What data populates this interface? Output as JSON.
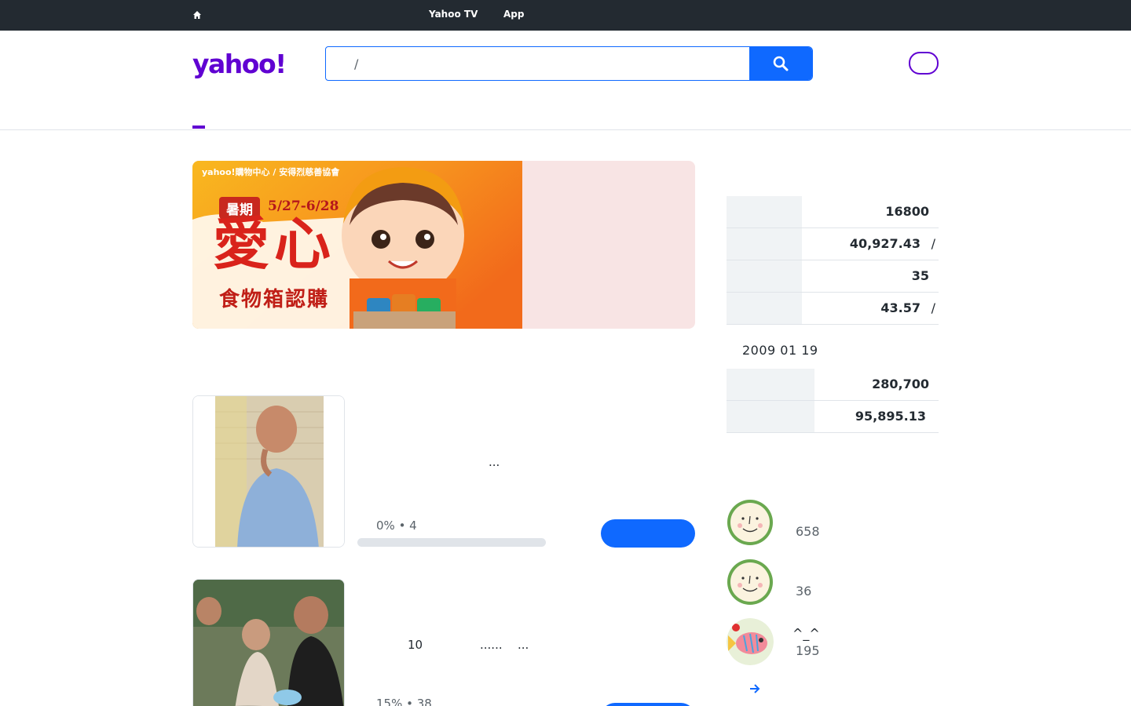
{
  "topbar": {
    "nav": [
      "Yahoo TV",
      "App"
    ]
  },
  "header": {
    "logo_text": "yahoo!",
    "search": {
      "value": "/"
    }
  },
  "banner": {
    "brand": "yahoo!購物中心 / 安得烈慈善協會",
    "tag": "暑期",
    "dates": "5/27-6/28",
    "headline": "愛心",
    "subhead": "食物箱認購"
  },
  "cards": [
    {
      "title": "...",
      "meta": "0% • 4",
      "progress": 0.0
    },
    {
      "title_parts": [
        "10",
        "......",
        "..."
      ],
      "meta": "15% • 38",
      "progress": 0.15
    }
  ],
  "stats": {
    "rows": [
      {
        "value": "16800",
        "unit": ""
      },
      {
        "value": "40,927.43",
        "unit": "/"
      },
      {
        "value": "35",
        "unit": ""
      },
      {
        "value": "43.57",
        "unit": "/"
      }
    ],
    "date": "2009 01 19",
    "rows2": [
      {
        "value": "280,700"
      },
      {
        "value": "95,895.13"
      }
    ]
  },
  "donors": [
    {
      "name": "",
      "count": "658",
      "avatar": "smiley-face"
    },
    {
      "name": "",
      "count": "36",
      "avatar": "smiley-face"
    },
    {
      "name": "^_^",
      "count": "195",
      "avatar": "fish-drawing"
    }
  ],
  "colors": {
    "brand": "#6001d2",
    "accent": "#0f69ff",
    "topbar": "#232a31"
  }
}
